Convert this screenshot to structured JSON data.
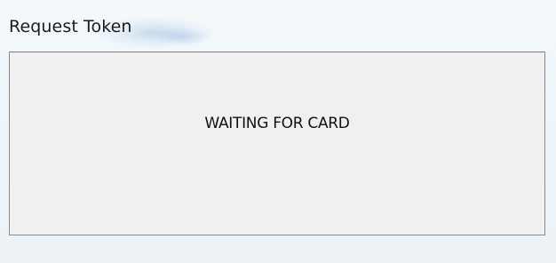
{
  "window": {
    "title": "Request Token"
  },
  "panel": {
    "status_text": "WAITING FOR CARD"
  },
  "colors": {
    "window_background": "#eef4f8",
    "panel_background": "#f0f0f0",
    "panel_border": "#8a8a8a",
    "text": "#111111"
  }
}
